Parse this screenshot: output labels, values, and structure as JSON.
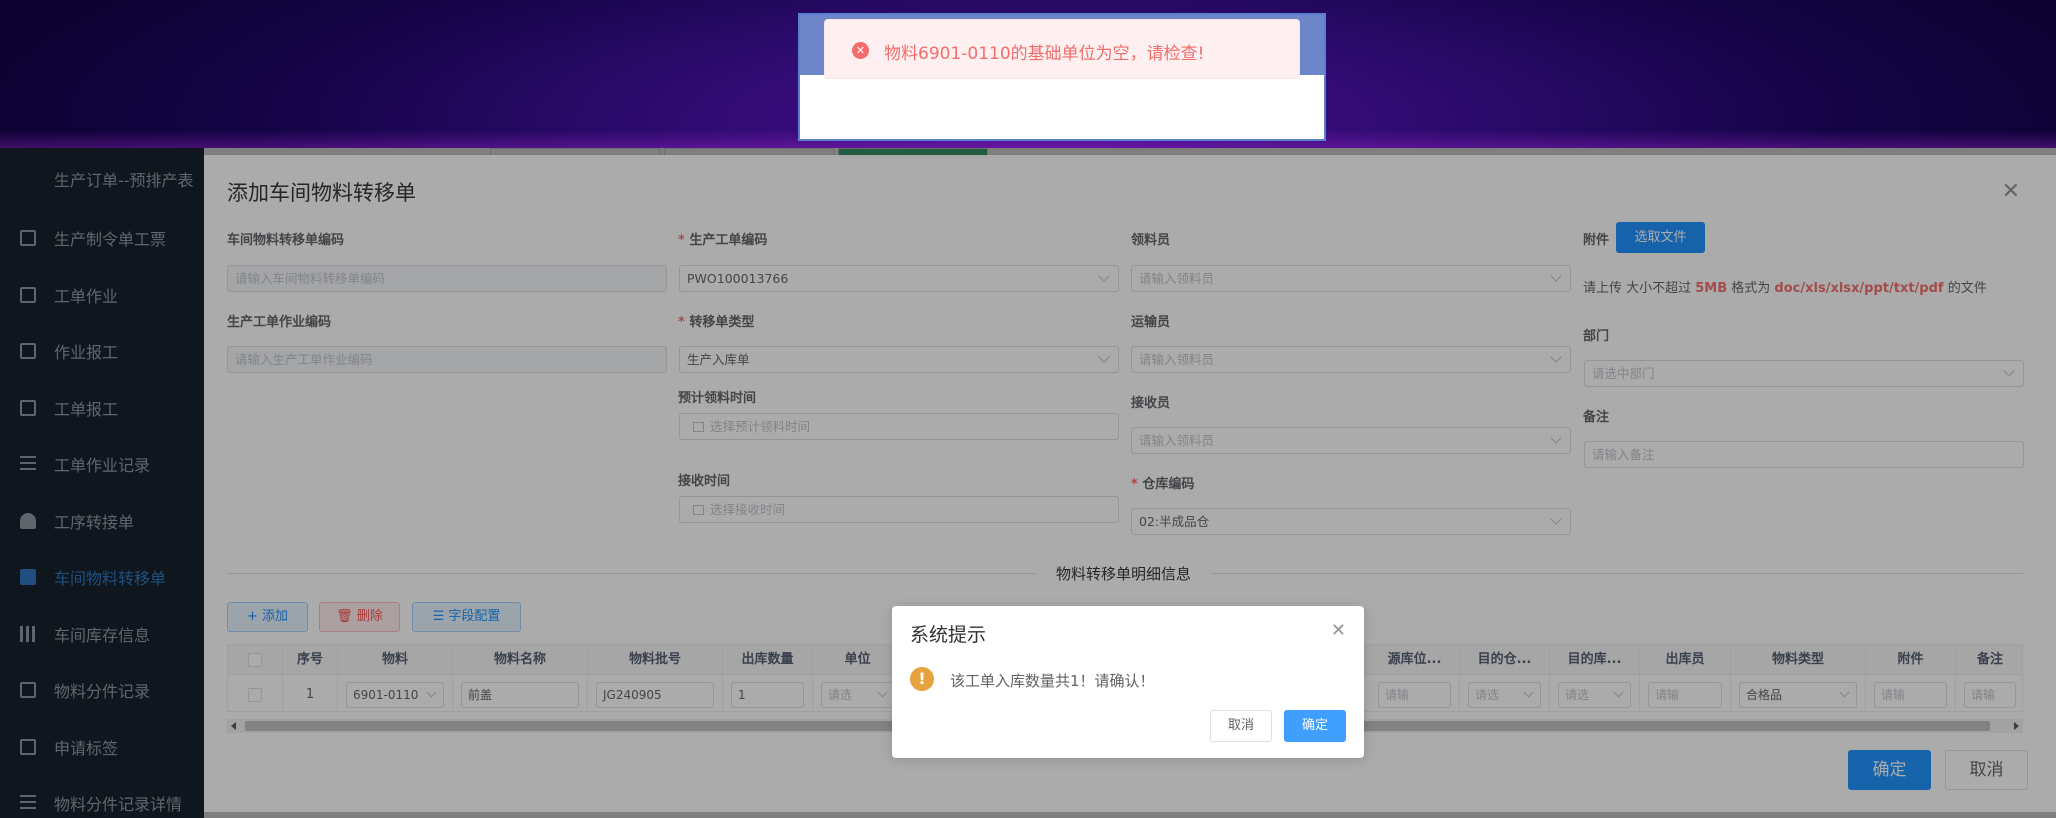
{
  "sidebar": {
    "items": [
      {
        "label": "生产订单--预排产表",
        "icon": "none"
      },
      {
        "label": "生产制令单工票",
        "icon": "document-icon"
      },
      {
        "label": "工单作业",
        "icon": "edit-icon"
      },
      {
        "label": "作业报工",
        "icon": "external-link-icon"
      },
      {
        "label": "工单报工",
        "icon": "book-icon"
      },
      {
        "label": "工单作业记录",
        "icon": "list-icon"
      },
      {
        "label": "工序转接单",
        "icon": "user-icon"
      },
      {
        "label": "车间物料转移单",
        "icon": "transfer-icon",
        "active": true
      },
      {
        "label": "车间库存信息",
        "icon": "bar-chart-icon"
      },
      {
        "label": "物料分件记录",
        "icon": "table-icon"
      },
      {
        "label": "申请标签",
        "icon": "image-icon"
      },
      {
        "label": "物料分件记录详情",
        "icon": "layers-icon"
      }
    ]
  },
  "toast": {
    "message": "物料6901-0110的基础单位为空，请检查!"
  },
  "dialog": {
    "title": "添加车间物料转移单",
    "fields": {
      "transfer_code": {
        "label": "车间物料转移单编码",
        "placeholder": "请输入车间物料转移单编码"
      },
      "job_code": {
        "label": "生产工单作业编码",
        "placeholder": "请输入生产工单作业编码"
      },
      "work_order": {
        "label": "生产工单编码",
        "value": "PWO100013766"
      },
      "transfer_type": {
        "label": "转移单类型",
        "value": "生产入库单"
      },
      "plan_time": {
        "label": "预计领料时间",
        "placeholder": "选择预计领料时间"
      },
      "receive_time": {
        "label": "接收时间",
        "placeholder": "选择接收时间"
      },
      "picker": {
        "label": "领料员",
        "placeholder": "请输入领料员"
      },
      "transporter": {
        "label": "运输员",
        "placeholder": "请输入领料员"
      },
      "receiver": {
        "label": "接收员",
        "placeholder": "请输入领料员"
      },
      "warehouse": {
        "label": "仓库编码",
        "value": "02:半成品仓"
      },
      "attachment": {
        "label": "附件",
        "button": "选取文件",
        "tip_pre": "请上传 大小不超过 ",
        "tip_size": "5MB",
        "tip_mid": " 格式为 ",
        "tip_fmt": "doc/xls/xlsx/ppt/txt/pdf",
        "tip_post": " 的文件"
      },
      "department": {
        "label": "部门",
        "placeholder": "请选中部门"
      },
      "remark": {
        "label": "备注",
        "placeholder": "请输入备注"
      }
    },
    "section_title": "物料转移单明细信息",
    "toolbar": {
      "add": "+ 添加",
      "delete": "删除",
      "columns": "字段配置"
    },
    "table": {
      "headers": [
        "序号",
        "物料",
        "物料名称",
        "物料批号",
        "出库数量",
        "单位",
        "源库位...",
        "目的仓...",
        "目的库...",
        "出库员",
        "物料类型",
        "附件",
        "备注"
      ],
      "row": {
        "index": "1",
        "material": "6901-0110",
        "name": "前盖",
        "batch": "JG240905",
        "qty": "1",
        "unit_ph": "请选",
        "src_loc_ph": "请输",
        "dst_wh_ph": "请选",
        "dst_loc_ph": "请选",
        "operator_ph": "请输",
        "type": "合格品",
        "attach_ph": "请输",
        "remark_ph": "请输"
      }
    },
    "ok": "确定",
    "cancel": "取消"
  },
  "msgbox": {
    "title": "系统提示",
    "message": "该工单入库数量共1！请确认！",
    "cancel": "取消",
    "ok": "确定"
  },
  "colors": {
    "primary": "#1890ff",
    "danger": "#f56c6c",
    "warning": "#e6a23c",
    "sidebar": "#1f2d3d"
  }
}
